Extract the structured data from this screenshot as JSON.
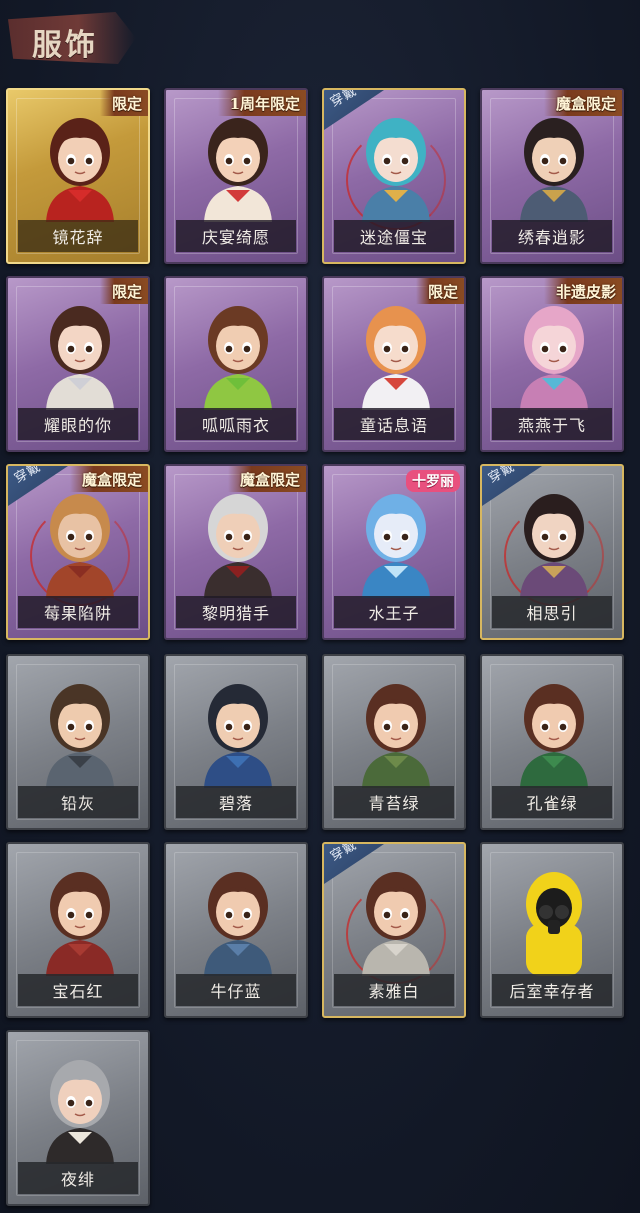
{
  "header": {
    "title": "服饰"
  },
  "outfits": [
    {
      "name": "镜花辞",
      "tier": "gold",
      "badge": "限定",
      "equipped": false,
      "palette": {
        "skin": "#f2cfb6",
        "hair": "#5a2218",
        "outfit": "#b8231f",
        "accent": "#d62c2a"
      }
    },
    {
      "name": "庆宴绮愿",
      "tier": "purple",
      "badge": "1周年限定",
      "equipped": false,
      "palette": {
        "skin": "#f3d1b8",
        "hair": "#3a241c",
        "outfit": "#f2e6d8",
        "accent": "#d23a3a"
      }
    },
    {
      "name": "迷途僵宝",
      "tier": "purple",
      "badge": "",
      "equipped": true,
      "palette": {
        "skin": "#f4ddd0",
        "hair": "#3fb2c4",
        "outfit": "#4a7fa8",
        "accent": "#e0b04a"
      }
    },
    {
      "name": "绣春逍影",
      "tier": "purple",
      "badge": "魔盒限定",
      "equipped": false,
      "palette": {
        "skin": "#efd0b7",
        "hair": "#2a2020",
        "outfit": "#4d5c74",
        "accent": "#c9a24c"
      }
    },
    {
      "name": "耀眼的你",
      "tier": "purple",
      "badge": "限定",
      "equipped": false,
      "palette": {
        "skin": "#f3d6c5",
        "hair": "#4a2a20",
        "outfit": "#e2ddd6",
        "accent": "#cfcfd6"
      }
    },
    {
      "name": "呱呱雨衣",
      "tier": "purple",
      "badge": "",
      "equipped": false,
      "palette": {
        "skin": "#f0cdb2",
        "hair": "#6b3a24",
        "outfit": "#8fc742",
        "accent": "#6fbf3a"
      }
    },
    {
      "name": "童话息语",
      "tier": "purple",
      "badge": "限定",
      "equipped": false,
      "palette": {
        "skin": "#f6dccc",
        "hair": "#e7924e",
        "outfit": "#f2f0f3",
        "accent": "#d6463c"
      }
    },
    {
      "name": "燕燕于飞",
      "tier": "purple",
      "badge": "非遗皮影",
      "equipped": false,
      "palette": {
        "skin": "#f5d5d8",
        "hair": "#e6a6c8",
        "outfit": "#c77fb4",
        "accent": "#58b8d6"
      }
    },
    {
      "name": "莓果陷阱",
      "tier": "purple",
      "badge": "魔盒限定",
      "equipped": true,
      "palette": {
        "skin": "#e8c2a4",
        "hair": "#c78a4c",
        "outfit": "#a2452a",
        "accent": "#8a2e22"
      }
    },
    {
      "name": "黎明猎手",
      "tier": "purple",
      "badge": "魔盒限定",
      "equipped": false,
      "palette": {
        "skin": "#efcfb8",
        "hair": "#d6d6d6",
        "outfit": "#3a2e2e",
        "accent": "#8a2020"
      }
    },
    {
      "name": "水王子",
      "tier": "purple",
      "badge": "十罗丽",
      "equipped": false,
      "palette": {
        "skin": "#e6ecf8",
        "hair": "#6fb0e6",
        "outfit": "#3a86c4",
        "accent": "#bfe3f7"
      }
    },
    {
      "name": "相思引",
      "tier": "grey",
      "badge": "",
      "equipped": true,
      "palette": {
        "skin": "#f0d4c2",
        "hair": "#2a1e1e",
        "outfit": "#6b4a78",
        "accent": "#c9a25a"
      }
    },
    {
      "name": "铅灰",
      "tier": "grey",
      "badge": "",
      "equipped": false,
      "palette": {
        "skin": "#eecbae",
        "hair": "#4a3526",
        "outfit": "#5a6470",
        "accent": "#3a4048"
      }
    },
    {
      "name": "碧落",
      "tier": "grey",
      "badge": "",
      "equipped": false,
      "palette": {
        "skin": "#efcdb2",
        "hair": "#252a36",
        "outfit": "#2e4e86",
        "accent": "#3d6fb2"
      }
    },
    {
      "name": "青苔绿",
      "tier": "grey",
      "badge": "",
      "equipped": false,
      "palette": {
        "skin": "#f0cbb0",
        "hair": "#5a2f22",
        "outfit": "#4b6a3a",
        "accent": "#6d8a4a"
      }
    },
    {
      "name": "孔雀绿",
      "tier": "grey",
      "badge": "",
      "equipped": false,
      "palette": {
        "skin": "#f0cbb0",
        "hair": "#5a2f22",
        "outfit": "#2e6a3e",
        "accent": "#3d8a4e"
      }
    },
    {
      "name": "宝石红",
      "tier": "grey",
      "badge": "",
      "equipped": false,
      "palette": {
        "skin": "#f0cbb0",
        "hair": "#5a2f22",
        "outfit": "#8a2a26",
        "accent": "#a83a32"
      }
    },
    {
      "name": "牛仔蓝",
      "tier": "grey",
      "badge": "",
      "equipped": false,
      "palette": {
        "skin": "#f0cbb0",
        "hair": "#5a2f22",
        "outfit": "#3e5a7a",
        "accent": "#5a7ea8"
      }
    },
    {
      "name": "素雅白",
      "tier": "grey",
      "badge": "",
      "equipped": true,
      "palette": {
        "skin": "#f0cbb0",
        "hair": "#5a2f22",
        "outfit": "#b9b6ae",
        "accent": "#d8d4cc"
      }
    },
    {
      "name": "后室幸存者",
      "tier": "grey",
      "badge": "",
      "equipped": false,
      "palette": {
        "skin": "#1c1c1c",
        "hair": "#f1d21a",
        "outfit": "#f1d21a",
        "accent": "#111111"
      }
    },
    {
      "name": "夜绯",
      "tier": "grey",
      "badge": "",
      "equipped": false,
      "palette": {
        "skin": "#efd0bd",
        "hair": "#a7a9ad",
        "outfit": "#2e2a2a",
        "accent": "#ece6dc"
      }
    }
  ],
  "labels": {
    "worn": "穿戴"
  }
}
